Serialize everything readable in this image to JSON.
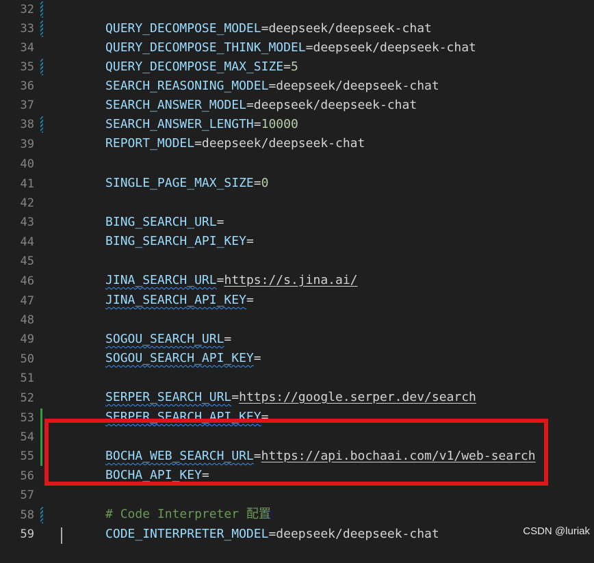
{
  "editor": {
    "lines": [
      {
        "num": "32",
        "key": "QUERY_DECOMPOSE_MODEL",
        "op": "=",
        "value": "deepseek/deepseek-chat"
      },
      {
        "num": "33",
        "key": "QUERY_DECOMPOSE_THINK_MODEL",
        "op": "=",
        "value": "deepseek/deepseek-chat"
      },
      {
        "num": "34",
        "key": "QUERY_DECOMPOSE_MAX_SIZE",
        "op": "=",
        "value": "5"
      },
      {
        "num": "35",
        "key": "SEARCH_REASONING_MODEL",
        "op": "=",
        "value": "deepseek/deepseek-chat"
      },
      {
        "num": "36",
        "key": "SEARCH_ANSWER_MODEL",
        "op": "=",
        "value": "deepseek/deepseek-chat"
      },
      {
        "num": "37",
        "key": "SEARCH_ANSWER_LENGTH",
        "op": "=",
        "value": "10000"
      },
      {
        "num": "38",
        "key": "REPORT_MODEL",
        "op": "=",
        "value": "deepseek/deepseek-chat"
      },
      {
        "num": "39"
      },
      {
        "num": "40",
        "key": "SINGLE_PAGE_MAX_SIZE",
        "op": "=",
        "value": "0"
      },
      {
        "num": "41"
      },
      {
        "num": "42",
        "key": "BING_SEARCH_URL",
        "op": "="
      },
      {
        "num": "43",
        "key": "BING_SEARCH_API_KEY",
        "op": "="
      },
      {
        "num": "44"
      },
      {
        "num": "45",
        "key": "JINA_SEARCH_URL",
        "op": "=",
        "value": "https://s.jina.ai/"
      },
      {
        "num": "46",
        "key": "JINA_SEARCH_API_KEY",
        "op": "="
      },
      {
        "num": "47"
      },
      {
        "num": "48",
        "key": "SOGOU_SEARCH_URL",
        "op": "="
      },
      {
        "num": "49",
        "key": "SOGOU_SEARCH_API_KEY",
        "op": "="
      },
      {
        "num": "50"
      },
      {
        "num": "51",
        "key": "SERPER_SEARCH_URL",
        "op": "=",
        "value": "https://google.serper.dev/search"
      },
      {
        "num": "52",
        "key": "SERPER_SEARCH_API_KEY",
        "op": "="
      },
      {
        "num": "53"
      },
      {
        "num": "54",
        "key": "BOCHA_WEB_SEARCH_URL",
        "op": "=",
        "value": "https://api.bochaai.com/v1/web-search"
      },
      {
        "num": "55",
        "key": "BOCHA_API_KEY",
        "op": "="
      },
      {
        "num": "56"
      },
      {
        "num": "57",
        "comment": "# Code Interpreter 配置"
      },
      {
        "num": "58",
        "key": "CODE_INTERPRETER_MODEL",
        "op": "=",
        "value": "deepseek/deepseek-chat"
      },
      {
        "num": "59"
      }
    ]
  },
  "annotation": {
    "box_color": "#e0151a"
  },
  "watermark": {
    "text": "CSDN @luriak"
  },
  "colors": {
    "background": "#1f1f1f",
    "key": "#9cdcfe",
    "number": "#b5cea8",
    "comment": "#6a9955",
    "line_number": "#858585",
    "modified_gutter": "#1b81a8",
    "added_gutter": "#2ea043"
  }
}
